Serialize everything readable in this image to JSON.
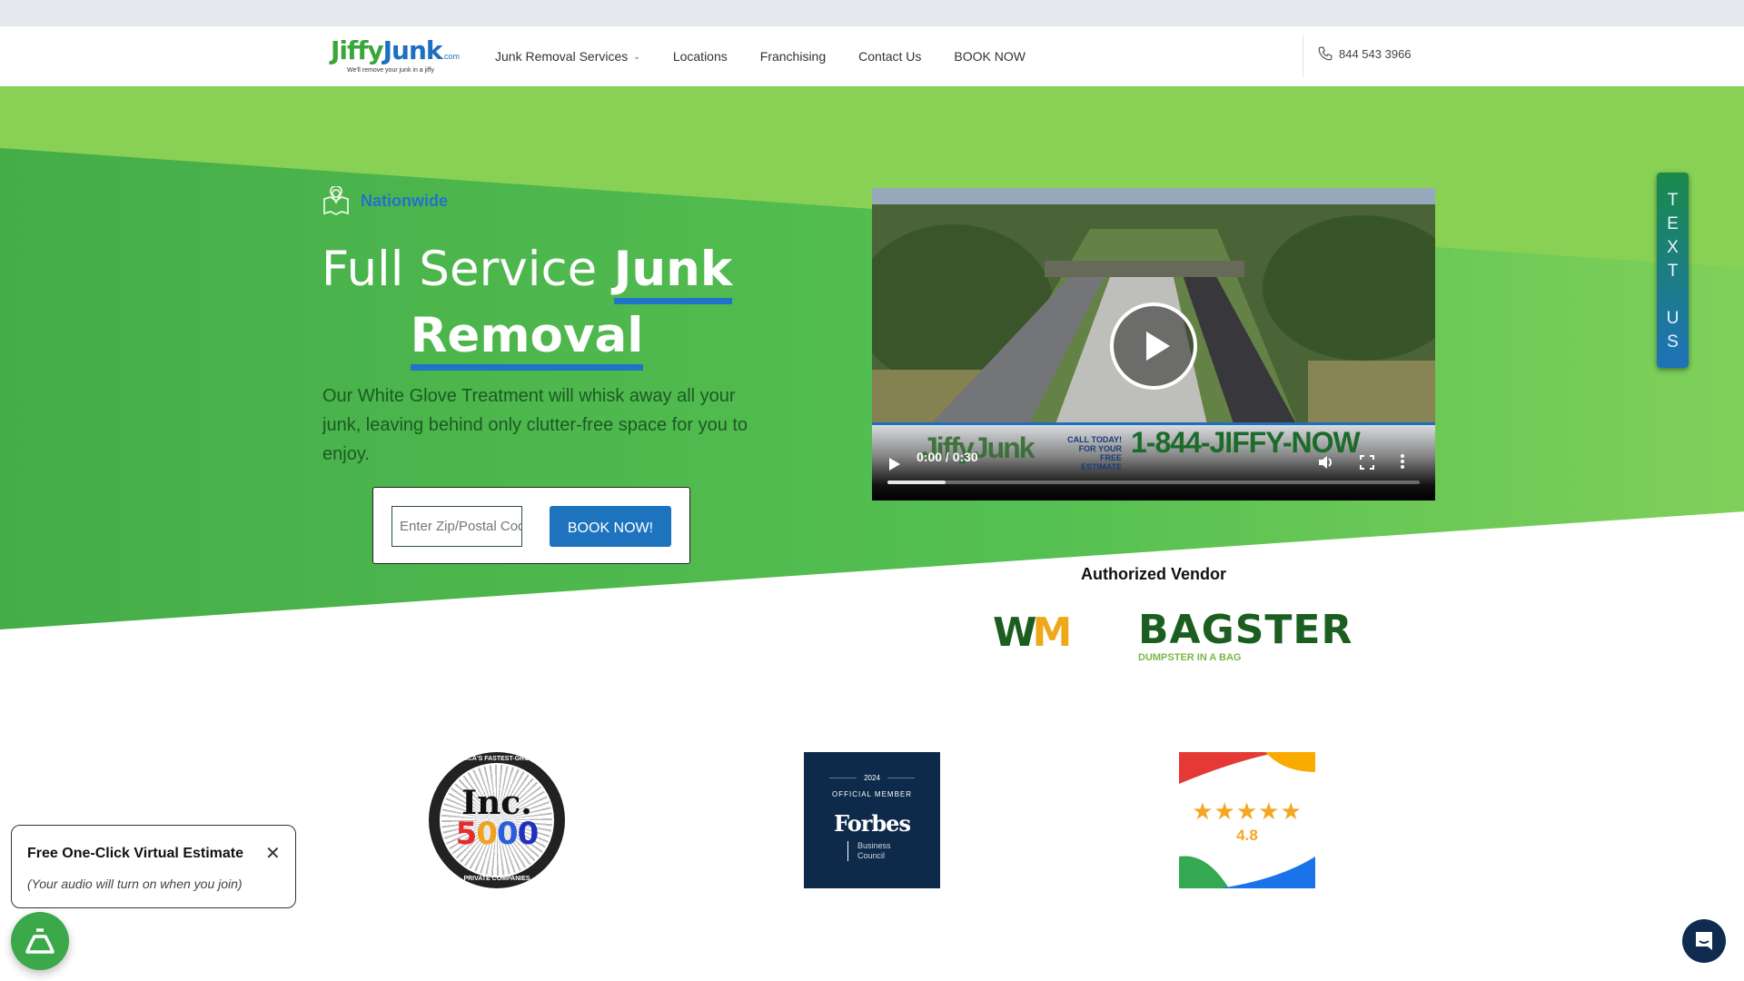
{
  "header": {
    "logo": {
      "name_part1": "Jiffy",
      "name_part2": "Junk",
      "suffix": ".com",
      "tagline": "We'll remove your junk in a jiffy"
    },
    "nav": [
      {
        "label": "Junk Removal Services",
        "has_dropdown": true
      },
      {
        "label": "Locations"
      },
      {
        "label": "Franchising"
      },
      {
        "label": "Contact Us"
      },
      {
        "label": "BOOK NOW"
      }
    ],
    "phone": "844 543 3966"
  },
  "hero": {
    "badge": "Nationwide",
    "headline_light": "Full Service",
    "headline_bold_1": "Junk",
    "headline_bold_2": "Removal",
    "description": "Our White Glove Treatment will whisk away all your junk, leaving behind only clutter-free space for you to enjoy.",
    "zip_placeholder": "Enter Zip/Postal Code",
    "book_button": "BOOK NOW!"
  },
  "video": {
    "time": "0:00 / 0:30",
    "progress_buffered": 0.11,
    "ad_logo": "JiffyJunk",
    "ad_call": "CALL TODAY! FOR YOUR FREE ESTIMATE",
    "ad_number": "1-844-JIFFY-NOW"
  },
  "text_us": {
    "letters": "T E X T  U S"
  },
  "vendors": {
    "title": "Authorized Vendor",
    "wm": {
      "w": "W",
      "m": "M"
    },
    "bagster": "BAGSTER",
    "bagster_tag": "DUMPSTER IN A BAG"
  },
  "badges": {
    "inc": {
      "top_arc": "AMERICA'S FASTEST-GROWING",
      "name": "Inc.",
      "digits": [
        "5",
        "0",
        "0",
        "0"
      ],
      "bottom_arc": "PRIVATE COMPANIES"
    },
    "forbes": {
      "year": "2024",
      "member": "OFFICIAL MEMBER",
      "name": "Forbes",
      "council_1": "Business",
      "council_2": "Council"
    },
    "google": {
      "stars": "★★★★★",
      "rating": "4.8"
    }
  },
  "estimate_popup": {
    "title": "Free One-Click Virtual Estimate",
    "subtitle": "(Your audio will turn on when you join)"
  },
  "colors": {
    "light_green": "#88d155",
    "hero_green": "#4cb84c",
    "brand_blue": "#1e73be",
    "dark_navy": "#0e2a4a"
  }
}
